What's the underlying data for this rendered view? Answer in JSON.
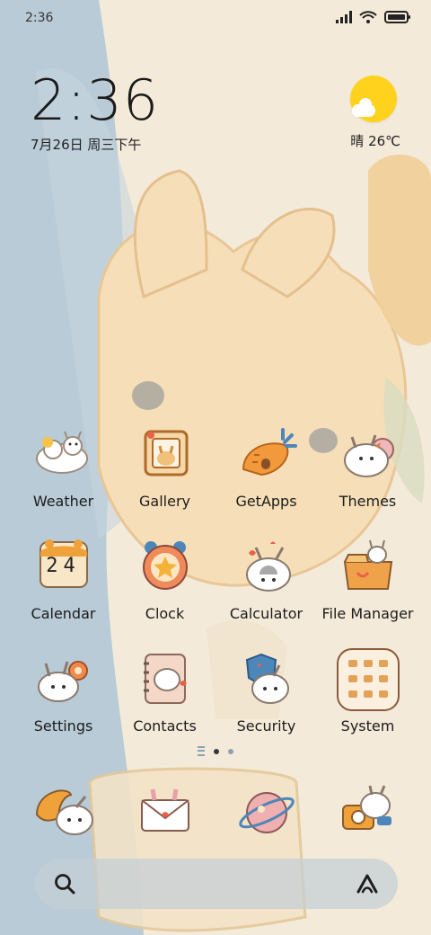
{
  "status_bar": {
    "time": "2:36"
  },
  "clock_widget": {
    "time": "2:36",
    "date": "7月26日 周三下午"
  },
  "weather_widget": {
    "text": "晴 26℃"
  },
  "apps": [
    {
      "label": "Weather",
      "icon": "weather-icon"
    },
    {
      "label": "Gallery",
      "icon": "gallery-icon"
    },
    {
      "label": "GetApps",
      "icon": "getapps-icon"
    },
    {
      "label": "Themes",
      "icon": "themes-icon"
    },
    {
      "label": "Calendar",
      "icon": "calendar-icon",
      "day": "24"
    },
    {
      "label": "Clock",
      "icon": "clock-icon"
    },
    {
      "label": "Calculator",
      "icon": "calculator-icon"
    },
    {
      "label": "File Manager",
      "icon": "file-manager-icon"
    },
    {
      "label": "Settings",
      "icon": "settings-icon"
    },
    {
      "label": "Contacts",
      "icon": "contacts-icon"
    },
    {
      "label": "Security",
      "icon": "security-icon"
    },
    {
      "label": "System",
      "icon": "system-folder-icon"
    }
  ],
  "page_indicator": {
    "pages": 2,
    "active": 1
  },
  "dock": [
    {
      "icon": "phone-icon"
    },
    {
      "icon": "messages-icon"
    },
    {
      "icon": "browser-icon"
    },
    {
      "icon": "camera-icon"
    }
  ],
  "search_bar": {
    "left_icon": "search-icon",
    "right_icon": "assistant-icon"
  },
  "colors": {
    "background": "#f4ead9",
    "blue_panel": "#b9cbd6",
    "sun": "#ffd21e"
  }
}
